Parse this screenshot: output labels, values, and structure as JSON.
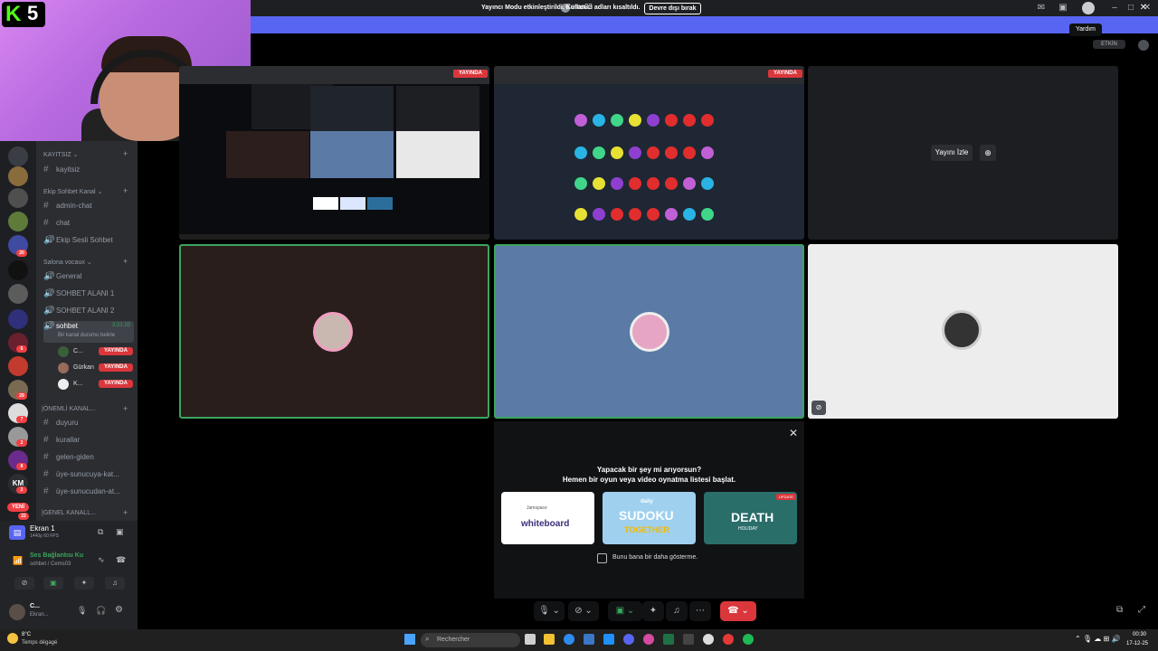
{
  "window": {
    "title": "Cems03"
  },
  "tooltip": "Yardım",
  "streamer_notice": {
    "text": "Yayıncı Modu etkinleştirildi. Kullanıcı adları kısaltıldı.",
    "button": "Devre dışı bırak"
  },
  "webcam": {
    "logo_k": "K",
    "logo_5": "5"
  },
  "server_badges": [
    "20",
    "6",
    "29",
    "7",
    "2",
    "8",
    "2"
  ],
  "server_text": "KM",
  "yeni_badge": "YENİ",
  "yeni_count": "22",
  "channels": {
    "cat_kayitsiz": "KAYITSIZ",
    "kayitsiz": "kayitsiz",
    "cat_ekip": "Ekip Sohbet Kanal",
    "admin_chat": "admin-chat",
    "chat": "chat",
    "ekip_sesli": "Ekip Sesli Sohbet",
    "cat_salona": "Salona vocaux",
    "general": "General",
    "sohbet1": "SOHBET ALANI 1",
    "sohbet2": "SOHBET ALANI 2",
    "sohbet": "sohbet",
    "sohbet_time": "3:21:20",
    "sohbet_status": "Bir kanal durumu belirle",
    "users": [
      {
        "name": "C...",
        "badge": "YAYINDA"
      },
      {
        "name": "Gürkan",
        "badge": "YAYINDA"
      },
      {
        "name": "K...",
        "badge": "YAYINDA"
      }
    ],
    "cat_onemli": "|ÖNEMLİ KANAL...",
    "duyuru": "duyuru",
    "kurallar": "kurallar",
    "gelen_giden": "gelen-giden",
    "uye_sun_kat": "üye-sunucuya-kat...",
    "uye_sun_at": "üye-sunucudan-at...",
    "cat_genel": "|GENEL KANALL..."
  },
  "stream_panel": {
    "name": "Ekran 1",
    "quality": "1440p 60 FPS"
  },
  "voice": {
    "status": "Ses Bağlantısı Ku",
    "channel": "sohbet / Cems03"
  },
  "user": {
    "name": "C...",
    "status": "Ekran..."
  },
  "etkin": "ETKİN",
  "tiles": {
    "yayinda": "YAYINDA",
    "watch_stream": "Yayını İzle"
  },
  "activity": {
    "title_line1": "Yapacak bir şey mi arıyorsun?",
    "title_line2": "Hemen bir oyun veya video oynatma listesi başlat.",
    "cards": [
      {
        "label": "whiteboard",
        "top": "Jamspace"
      },
      {
        "label": "SUDOKU",
        "top": "daily",
        "bottom": "TOGETHER"
      },
      {
        "label": "DEATH",
        "badge": "UPDATE",
        "bottom": "HOLIDAY"
      }
    ],
    "dont_show": "Bunu bana bir daha gösterme."
  },
  "taskbar": {
    "temp": "8°C",
    "weather": "Temps dégagé",
    "search": "Rechercher",
    "time": "00:30",
    "date": "17-12-25"
  },
  "colors": {
    "accent": "#5865f2",
    "live": "#da373c",
    "speaking": "#3ba55d",
    "kick": "#53fc18"
  }
}
